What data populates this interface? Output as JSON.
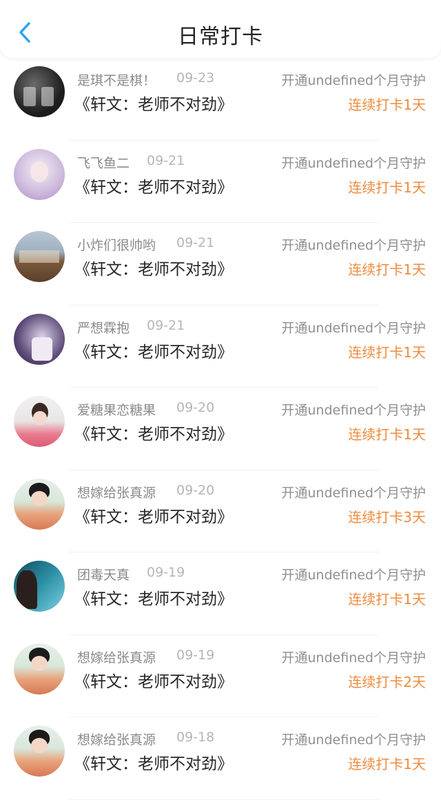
{
  "header": {
    "title": "日常打卡"
  },
  "colors": {
    "accent": "#2aa3ee",
    "streak": "#f08a3c"
  },
  "items": [
    {
      "name": "是琪不是棋！",
      "date": "09-23",
      "guard": "开通undefined个月守护",
      "book": "《轩文：老师不对劲》",
      "streak": "连续打卡1天",
      "avatar": "dark-group-photo"
    },
    {
      "name": "飞飞鱼二",
      "date": "09-21",
      "guard": "开通undefined个月守护",
      "book": "《轩文：老师不对劲》",
      "streak": "连续打卡1天",
      "avatar": "anime-girl-photo"
    },
    {
      "name": "小炸们很帅哟",
      "date": "09-21",
      "guard": "开通undefined个月守护",
      "book": "《轩文：老师不对劲》",
      "streak": "连续打卡1天",
      "avatar": "band-group-photo"
    },
    {
      "name": "严想霖抱",
      "date": "09-21",
      "guard": "开通undefined个月守护",
      "book": "《轩文：老师不对劲》",
      "streak": "连续打卡1天",
      "avatar": "purple-portrait-photo"
    },
    {
      "name": "爱糖果恋糖果",
      "date": "09-20",
      "guard": "开通undefined个月守护",
      "book": "《轩文：老师不对劲》",
      "streak": "连续打卡1天",
      "avatar": "pink-portrait-photo"
    },
    {
      "name": "想嫁给张真源",
      "date": "09-20",
      "guard": "开通undefined个月守护",
      "book": "《轩文：老师不对劲》",
      "streak": "连续打卡3天",
      "avatar": "boy-portrait-photo"
    },
    {
      "name": "团毒天真",
      "date": "09-19",
      "guard": "开通undefined个月守护",
      "book": "《轩文：老师不对劲》",
      "streak": "连续打卡1天",
      "avatar": "sea-girl-photo"
    },
    {
      "name": "想嫁给张真源",
      "date": "09-19",
      "guard": "开通undefined个月守护",
      "book": "《轩文：老师不对劲》",
      "streak": "连续打卡2天",
      "avatar": "boy-portrait-photo"
    },
    {
      "name": "想嫁给张真源",
      "date": "09-18",
      "guard": "开通undefined个月守护",
      "book": "《轩文：老师不对劲》",
      "streak": "连续打卡1天",
      "avatar": "boy-portrait-photo"
    }
  ]
}
